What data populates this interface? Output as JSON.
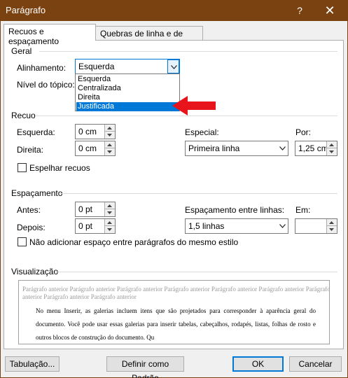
{
  "window": {
    "title": "Parágrafo",
    "help_glyph": "?",
    "close_glyph": "✕"
  },
  "tabs": {
    "active": "Recuos e espaçamento",
    "inactive": "Quebras de linha e de página"
  },
  "geral": {
    "section": "Geral",
    "alinhamento_label": "Alinhamento:",
    "alinhamento_value": "Esquerda",
    "nivel_label": "Nível do tópico:",
    "options": [
      "Esquerda",
      "Centralizada",
      "Direita",
      "Justificada"
    ]
  },
  "recuo": {
    "section": "Recuo",
    "esquerda_label": "Esquerda:",
    "esquerda_value": "0 cm",
    "direita_label": "Direita:",
    "direita_value": "0 cm",
    "especial_label": "Especial:",
    "especial_value": "Primeira linha",
    "por_label": "Por:",
    "por_value": "1,25 cm",
    "espelhar_label": "Espelhar recuos"
  },
  "espacamento": {
    "section": "Espaçamento",
    "antes_label": "Antes:",
    "antes_value": "0 pt",
    "depois_label": "Depois:",
    "depois_value": "0 pt",
    "entre_linhas_label": "Espaçamento entre linhas:",
    "entre_linhas_value": "1,5 linhas",
    "em_label": "Em:",
    "em_value": "",
    "nao_adicionar_label": "Não adicionar espaço entre parágrafos do mesmo estilo"
  },
  "visualizacao": {
    "section": "Visualização",
    "previous_text": "Parágrafo anterior Parágrafo anterior Parágrafo anterior Parágrafo anterior Parágrafo anterior Parágrafo anterior Parágrafo anterior Parágrafo anterior Parágrafo anterior",
    "current_text": "No menu Inserir, as galerias incluem itens que são projetados para corresponder à aparência geral do documento. Você pode usar essas galerias para inserir tabelas, cabeçalhos, rodapés, listas, folhas de rosto e outros blocos de construção do documento. Qu"
  },
  "buttons": {
    "tabulacao": "Tabulação...",
    "definir_padrao": "Definir como Padrão",
    "ok": "OK",
    "cancelar": "Cancelar"
  },
  "colors": {
    "titlebar": "#7a4210",
    "accent": "#0078d7",
    "arrow": "#e8141b"
  }
}
